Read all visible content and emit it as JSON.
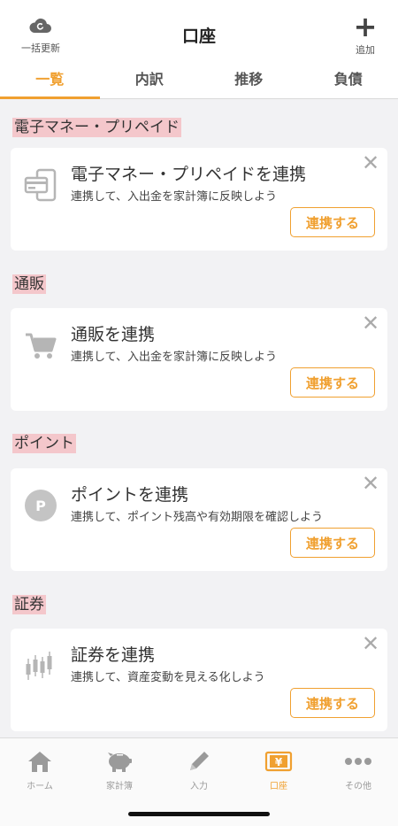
{
  "header": {
    "title": "口座",
    "refresh_label": "一括更新",
    "add_label": "追加",
    "add_symbol": "+"
  },
  "tabs": [
    {
      "label": "一覧",
      "active": true
    },
    {
      "label": "内訳",
      "active": false
    },
    {
      "label": "推移",
      "active": false
    },
    {
      "label": "負債",
      "active": false
    }
  ],
  "sections": [
    {
      "title": "電子マネー・プリペイド",
      "card_title": "電子マネー・プリペイドを連携",
      "card_desc": "連携して、入出金を家計簿に反映しよう",
      "button": "連携する",
      "icon": "prepaid-card-phone-icon"
    },
    {
      "title": "通販",
      "card_title": "通販を連携",
      "card_desc": "連携して、入出金を家計簿に反映しよう",
      "button": "連携する",
      "icon": "shopping-cart-icon"
    },
    {
      "title": "ポイント",
      "card_title": "ポイントを連携",
      "card_desc": "連携して、ポイント残高や有効期限を確認しよう",
      "button": "連携する",
      "icon": "point-icon",
      "icon_letter": "P"
    },
    {
      "title": "証券",
      "card_title": "証券を連携",
      "card_desc": "連携して、資産変動を見える化しよう",
      "button": "連携する",
      "icon": "candlestick-chart-icon"
    }
  ],
  "close_symbol": "✕",
  "bottom_nav": [
    {
      "label": "ホーム",
      "icon": "home-icon",
      "active": false
    },
    {
      "label": "家計簿",
      "icon": "piggy-bank-icon",
      "active": false
    },
    {
      "label": "入力",
      "icon": "pencil-icon",
      "active": false
    },
    {
      "label": "口座",
      "icon": "yen-wallet-icon",
      "active": true,
      "icon_text": "¥"
    },
    {
      "label": "その他",
      "icon": "more-dots-icon",
      "active": false
    }
  ],
  "colors": {
    "accent": "#f0a030",
    "section_highlight": "#f4c7cb",
    "background": "#f2f2f4"
  }
}
